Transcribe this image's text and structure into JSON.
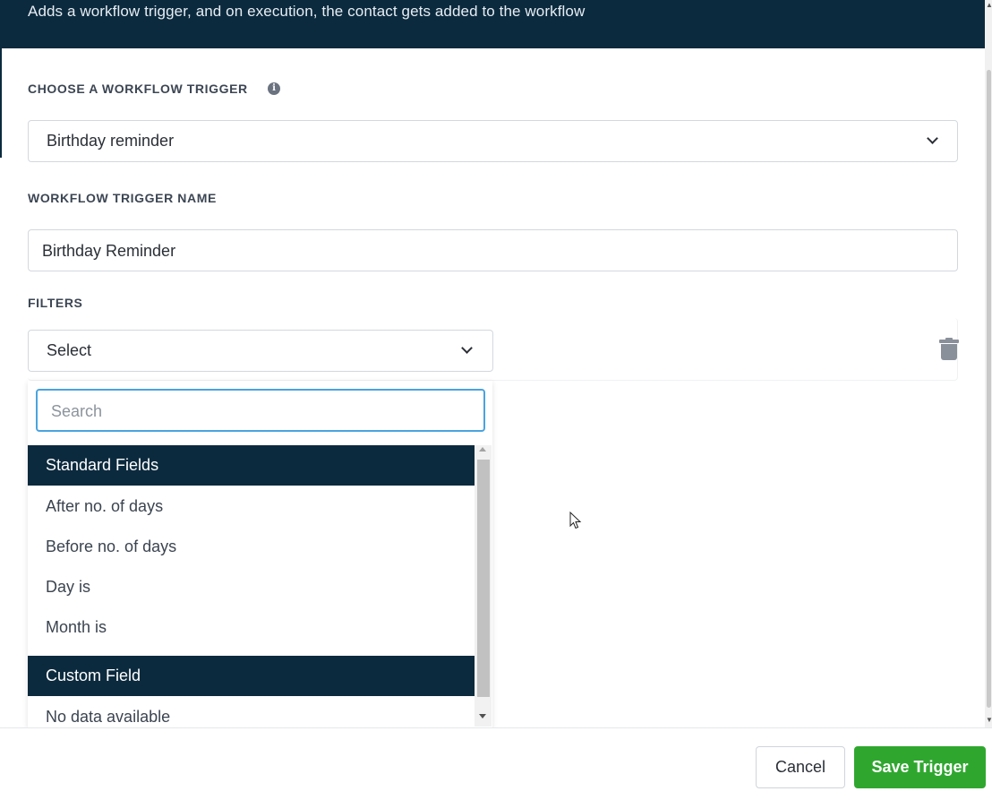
{
  "header": {
    "description": "Adds a workflow trigger, and on execution, the contact gets added to the workflow"
  },
  "trigger_select": {
    "label": "CHOOSE A WORKFLOW TRIGGER",
    "value": "Birthday reminder"
  },
  "trigger_name": {
    "label": "WORKFLOW TRIGGER NAME",
    "value": "Birthday Reminder"
  },
  "filters": {
    "label": "FILTERS",
    "select_value": "Select",
    "search_placeholder": "Search",
    "groups": [
      {
        "title": "Standard Fields",
        "options": [
          "After no. of days",
          "Before no. of days",
          "Day is",
          "Month is"
        ]
      },
      {
        "title": "Custom Field",
        "options": [
          "No data available"
        ]
      }
    ]
  },
  "footer": {
    "cancel_label": "Cancel",
    "save_label": "Save Trigger"
  },
  "colors": {
    "header_bg": "#0c2a3e",
    "save_button": "#2fa72f",
    "search_focus": "#4aa3df"
  },
  "icons": {
    "info": "info-icon",
    "chevron": "chevron-down-icon",
    "trash": "trash-icon"
  }
}
